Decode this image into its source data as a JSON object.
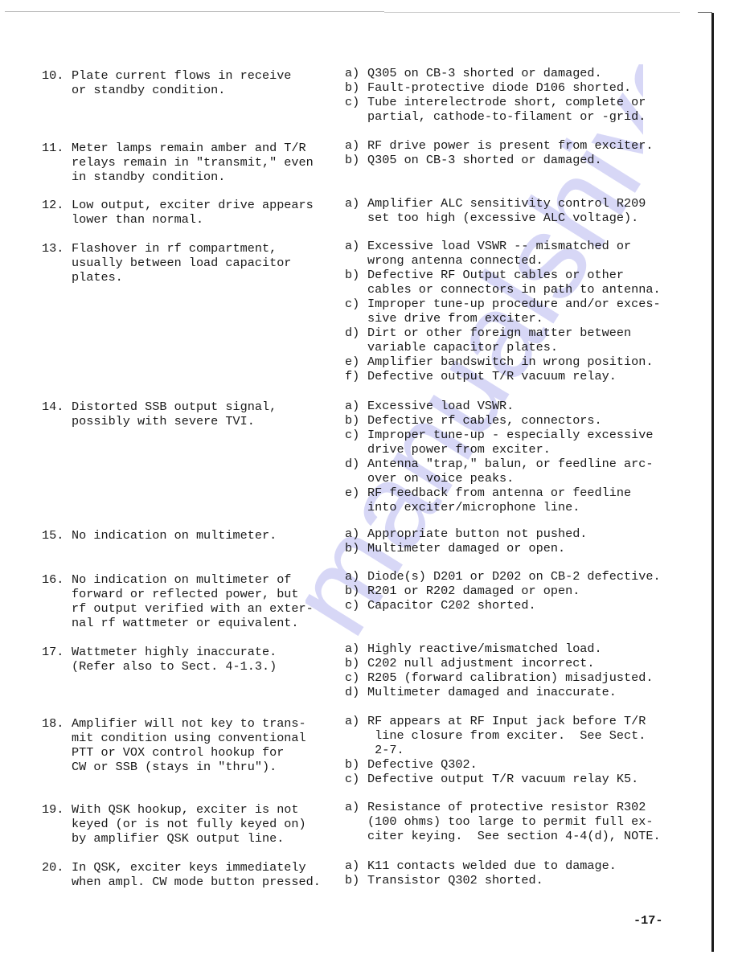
{
  "page_number": "-17-",
  "watermark": {
    "text": "manualshive.com",
    "color": "#b8b8f0"
  },
  "items": [
    {
      "num": "10.",
      "problem": [
        "Plate current flows in receive",
        "or standby condition."
      ],
      "causes": [
        {
          "label": "a)",
          "lines": [
            "Q305 on CB-3 shorted or damaged."
          ]
        },
        {
          "label": "b)",
          "lines": [
            "Fault-protective diode D106 shorted."
          ]
        },
        {
          "label": "c)",
          "lines": [
            "Tube interelectrode short, complete or",
            "partial, cathode-to-filament or -grid."
          ]
        }
      ]
    },
    {
      "num": "11.",
      "problem": [
        "Meter lamps remain amber and T/R",
        "relays remain in \"transmit,\" even",
        "in standby condition."
      ],
      "causes": [
        {
          "label": "a)",
          "lines": [
            "RF drive power is present from exciter."
          ]
        },
        {
          "label": "b)",
          "lines": [
            "Q305 on CB-3 shorted or damaged."
          ]
        }
      ]
    },
    {
      "num": "12.",
      "problem": [
        "Low output, exciter drive appears",
        "lower than normal."
      ],
      "causes": [
        {
          "label": "a)",
          "lines": [
            "Amplifier ALC sensitivity control R209",
            "set too high (excessive ALC voltage)."
          ]
        }
      ]
    },
    {
      "num": "13.",
      "problem": [
        "Flashover in rf compartment,",
        "usually between load capacitor",
        "plates."
      ],
      "causes": [
        {
          "label": "a)",
          "lines": [
            "Excessive load VSWR -- mismatched or",
            "wrong antenna connected."
          ]
        },
        {
          "label": "b)",
          "lines": [
            "Defective RF Output cables or other",
            "cables or connectors in path to antenna."
          ]
        },
        {
          "label": "c)",
          "lines": [
            "Improper tune-up procedure and/or exces-",
            "sive drive from exciter."
          ]
        },
        {
          "label": "d)",
          "lines": [
            "Dirt or other foreign matter between",
            "variable capacitor plates."
          ]
        },
        {
          "label": "e)",
          "lines": [
            "Amplifier bandswitch in wrong position."
          ]
        },
        {
          "label": "f)",
          "lines": [
            "Defective output T/R vacuum relay."
          ]
        }
      ]
    },
    {
      "num": "14.",
      "problem": [
        "Distorted SSB output signal,",
        "possibly with severe TVI."
      ],
      "causes": [
        {
          "label": "a)",
          "lines": [
            "Excessive load VSWR."
          ]
        },
        {
          "label": "b)",
          "lines": [
            "Defective rf cables, connectors."
          ]
        },
        {
          "label": "c)",
          "lines": [
            "Improper tune-up - especially excessive",
            "drive power from exciter."
          ]
        },
        {
          "label": "d)",
          "lines": [
            "Antenna \"trap,\" balun, or feedline arc-",
            "over on voice peaks."
          ]
        },
        {
          "label": "e)",
          "lines": [
            "RF feedback from antenna or feedline",
            "into exciter/microphone line."
          ]
        }
      ]
    },
    {
      "num": "15.",
      "problem": [
        "No indication on multimeter."
      ],
      "causes": [
        {
          "label": "a)",
          "lines": [
            "Appropriate button not pushed."
          ]
        },
        {
          "label": "b)",
          "lines": [
            "Multimeter damaged or open."
          ]
        }
      ]
    },
    {
      "num": "16.",
      "problem": [
        "No indication on multimeter of",
        "forward or reflected power, but",
        "rf output verified with an exter-",
        "nal rf wattmeter or equivalent."
      ],
      "causes": [
        {
          "label": "a)",
          "lines": [
            "Diode(s) D201 or D202 on CB-2 defective."
          ]
        },
        {
          "label": "b)",
          "lines": [
            "R201 or R202 damaged or open."
          ]
        },
        {
          "label": "c)",
          "lines": [
            "Capacitor C202 shorted."
          ]
        }
      ]
    },
    {
      "num": "17.",
      "problem": [
        "Wattmeter highly inaccurate.",
        "(Refer also to Sect. 4-1.3.)"
      ],
      "causes": [
        {
          "label": "a)",
          "lines": [
            "Highly reactive/mismatched load."
          ]
        },
        {
          "label": "b)",
          "lines": [
            "C202 null adjustment incorrect."
          ]
        },
        {
          "label": "c)",
          "lines": [
            "R205 (forward calibration) misadjusted."
          ]
        },
        {
          "label": "d)",
          "lines": [
            "Multimeter damaged and inaccurate."
          ]
        }
      ]
    },
    {
      "num": "18.",
      "problem": [
        "Amplifier will not key to trans-",
        "mit condition using conventional",
        "PTT or VOX control hookup for",
        "CW or SSB (stays in \"thru\")."
      ],
      "causes": [
        {
          "label": "a)",
          "lines": [
            "RF appears at RF Input jack before T/R",
            " line closure from exciter.  See Sect.",
            " 2-7."
          ]
        },
        {
          "label": "b)",
          "lines": [
            "Defective Q302."
          ]
        },
        {
          "label": "c)",
          "lines": [
            "Defective output T/R vacuum relay K5."
          ]
        }
      ]
    },
    {
      "num": "19.",
      "problem": [
        "With QSK hookup, exciter is not",
        "keyed (or is not fully keyed on)",
        "by amplifier QSK output line."
      ],
      "causes": [
        {
          "label": "a)",
          "lines": [
            "Resistance of protective resistor R302",
            "(100 ohms) too large to permit full ex-",
            "citer keying.  See section 4-4(d), NOTE."
          ]
        }
      ]
    },
    {
      "num": "20.",
      "problem": [
        "In QSK, exciter keys immediately",
        "when ampl. CW mode button pressed."
      ],
      "causes": [
        {
          "label": "a)",
          "lines": [
            "K11 contacts welded due to damage."
          ]
        },
        {
          "label": "b)",
          "lines": [
            "Transistor Q302 shorted."
          ]
        }
      ]
    }
  ]
}
